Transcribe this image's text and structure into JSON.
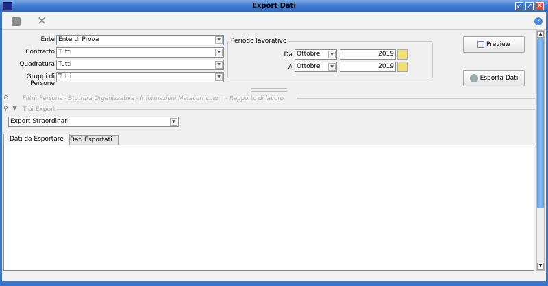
{
  "window": {
    "title": "Export Dati"
  },
  "toolbar": {
    "save": "save-icon",
    "close": "close-icon",
    "help": "help-icon"
  },
  "form": {
    "ente": {
      "label": "Ente",
      "value": "Ente di Prova"
    },
    "contratto": {
      "label": "Contratto",
      "value": "Tutti"
    },
    "quadratura": {
      "label": "Quadratura",
      "value": "Tutti"
    },
    "gruppi": {
      "label": "Gruppi di Persone",
      "value": "Tutti"
    }
  },
  "periodo": {
    "legend": "Periodo lavorativo",
    "da": {
      "label": "Da",
      "month": "Ottobre",
      "year": "2019"
    },
    "a": {
      "label": "A",
      "month": "Ottobre",
      "year": "2019"
    }
  },
  "buttons": {
    "preview": "Preview",
    "esporta": "Esporta Dati"
  },
  "filtri": {
    "label": "Filtri: Persona - Stuttura Organizzativa - Informazioni Metacurriculum - Rapporto di lavoro"
  },
  "tipi": {
    "label": "Tipi Export",
    "value": "Export Straordinari"
  },
  "tabs": [
    {
      "label": "Dati da Esportare",
      "active": true
    },
    {
      "label": "Dati Esportati",
      "active": false
    }
  ]
}
